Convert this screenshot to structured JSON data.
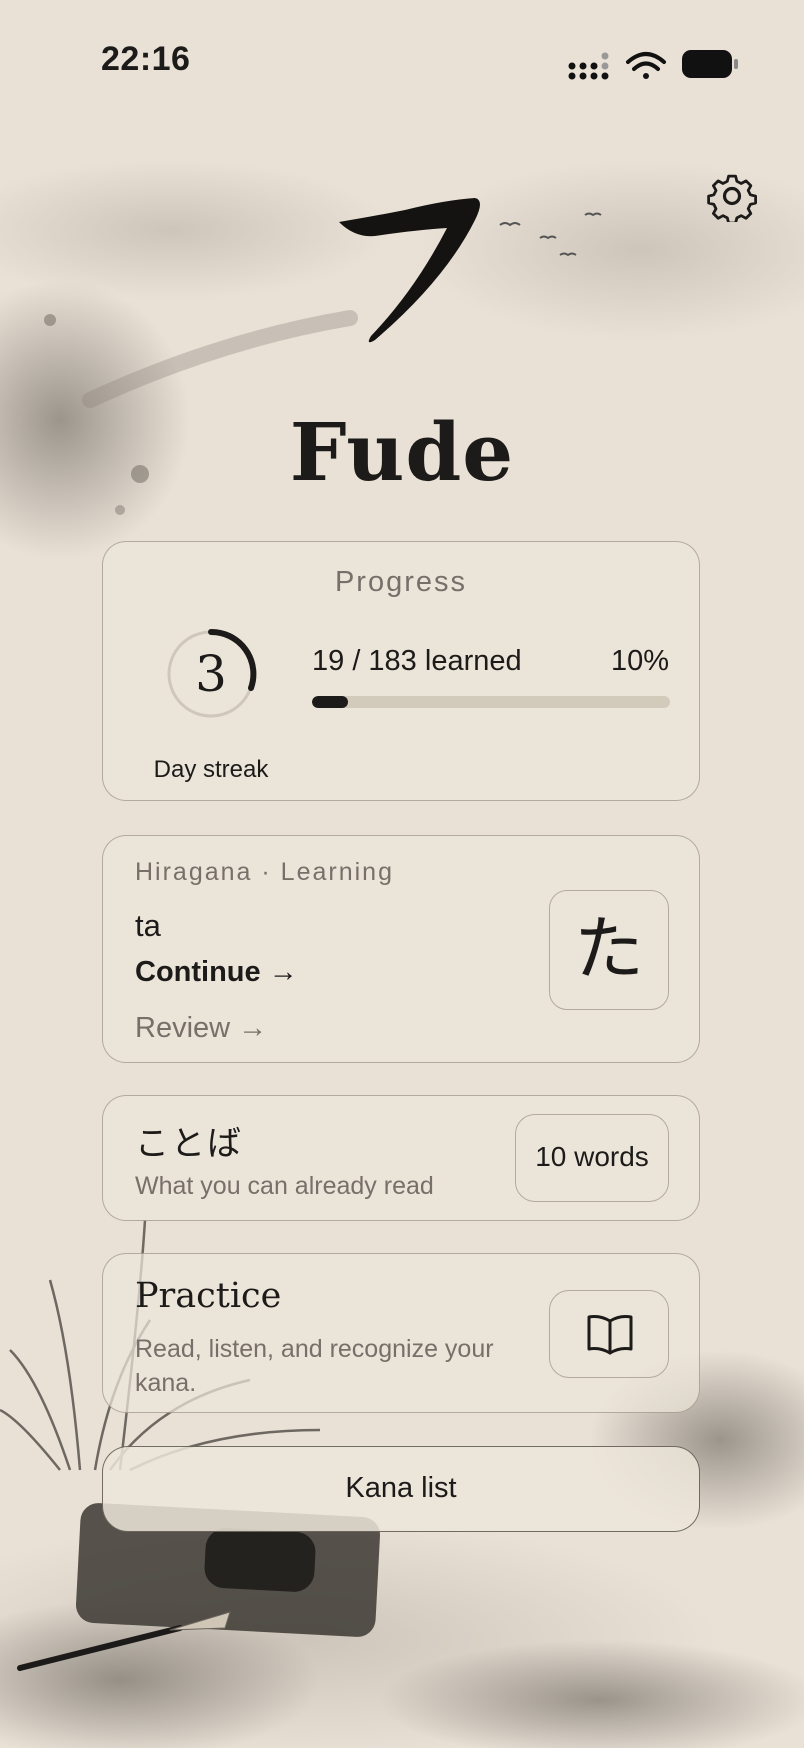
{
  "status_bar": {
    "time": "22:16",
    "icons": [
      "cellular-signal-icon",
      "wifi-icon",
      "battery-icon"
    ]
  },
  "header": {
    "app_title": "Fude",
    "logo_icon": "brush-stroke-logo-icon",
    "settings_icon": "gear-icon"
  },
  "progress": {
    "title": "Progress",
    "streak_count": "3",
    "streak_label": "Day streak",
    "learned_text": "19 / 183 learned",
    "percent_text": "10%",
    "percent_value": 0.1
  },
  "lesson": {
    "script_label": "Hiragana · Learning",
    "current_romaji": "ta",
    "current_kana": "た",
    "continue_label": "Continue →",
    "review_label": "Review →"
  },
  "words": {
    "title": "ことば",
    "subtitle": "What you can already read",
    "count_label": "10 words"
  },
  "practice": {
    "title": "Practice",
    "subtitle": "Read, listen, and recognize your kana.",
    "button_icon": "open-book-icon"
  },
  "kana_list_button": "Kana list",
  "colors": {
    "ink": "#1c1b19",
    "paper": "#e9e1d6",
    "muted_text": "#77706a",
    "track": "#d2cbbb"
  }
}
